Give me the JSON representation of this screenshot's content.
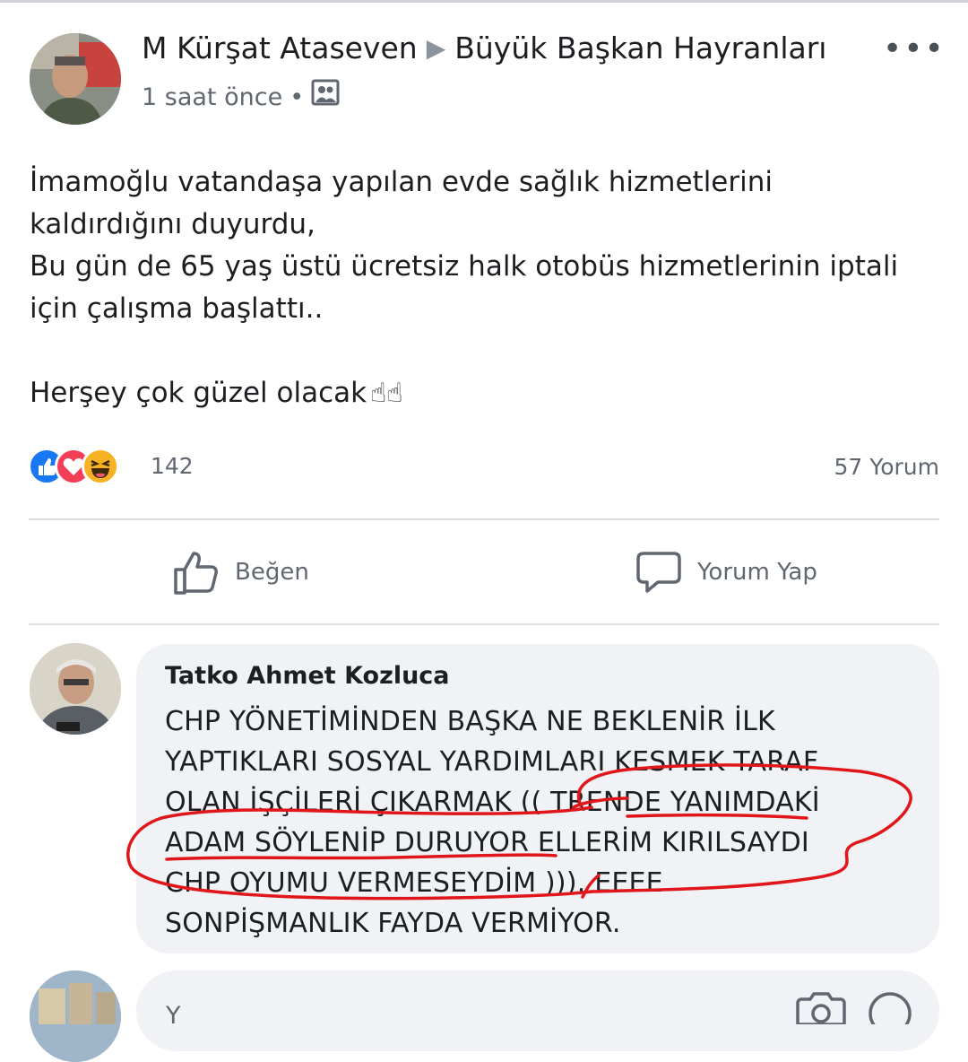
{
  "post": {
    "author": "M Kürşat Ataseven",
    "separator": "▶",
    "group": "Büyük Başkan Hayranları",
    "more_label": "•••",
    "time": "1 saat önce",
    "dot": "•",
    "text_lines": [
      "İmamoğlu vatandaşa yapılan evde sağlık hizmetlerini",
      "kaldırdığını duyurdu,",
      "Bu gün de 65 yaş üstü ücretsiz halk otobüs hizmetlerinin iptali",
      "için çalışma başlattı..",
      "Herşey çok güzel olacak"
    ],
    "emoji_suffix": "☝☝"
  },
  "reactions": {
    "count": "142",
    "comments": "57 Yorum",
    "icons": [
      "like-icon",
      "love-icon",
      "haha-icon"
    ],
    "colors": {
      "like": "#1877f2",
      "love": "#f33e58",
      "haha": "#f7b125"
    }
  },
  "actions": {
    "like_label": "Beğen",
    "comment_label": "Yorum Yap"
  },
  "comment": {
    "author": "Tatko Ahmet Kozluca",
    "lines": [
      "CHP YÖNETİMİNDEN BAŞKA NE BEKLENİR İLK",
      "YAPTIKLARI SOSYAL YARDIMLARI KESMEK TARAF",
      "OLAN İŞÇİLERİ ÇIKARMAK (( TRENDE YANIMDAKİ",
      "ADAM SÖYLENİP DURUYOR ELLERİM KIRILSAYDI",
      "CHP OYUMU VERMESEYDİM ))). EEEE",
      "SONPİŞMANLIK FAYDA VERMİYOR."
    ],
    "annotation_color": "#e0161b"
  },
  "reply": {
    "placeholder": "Y"
  }
}
